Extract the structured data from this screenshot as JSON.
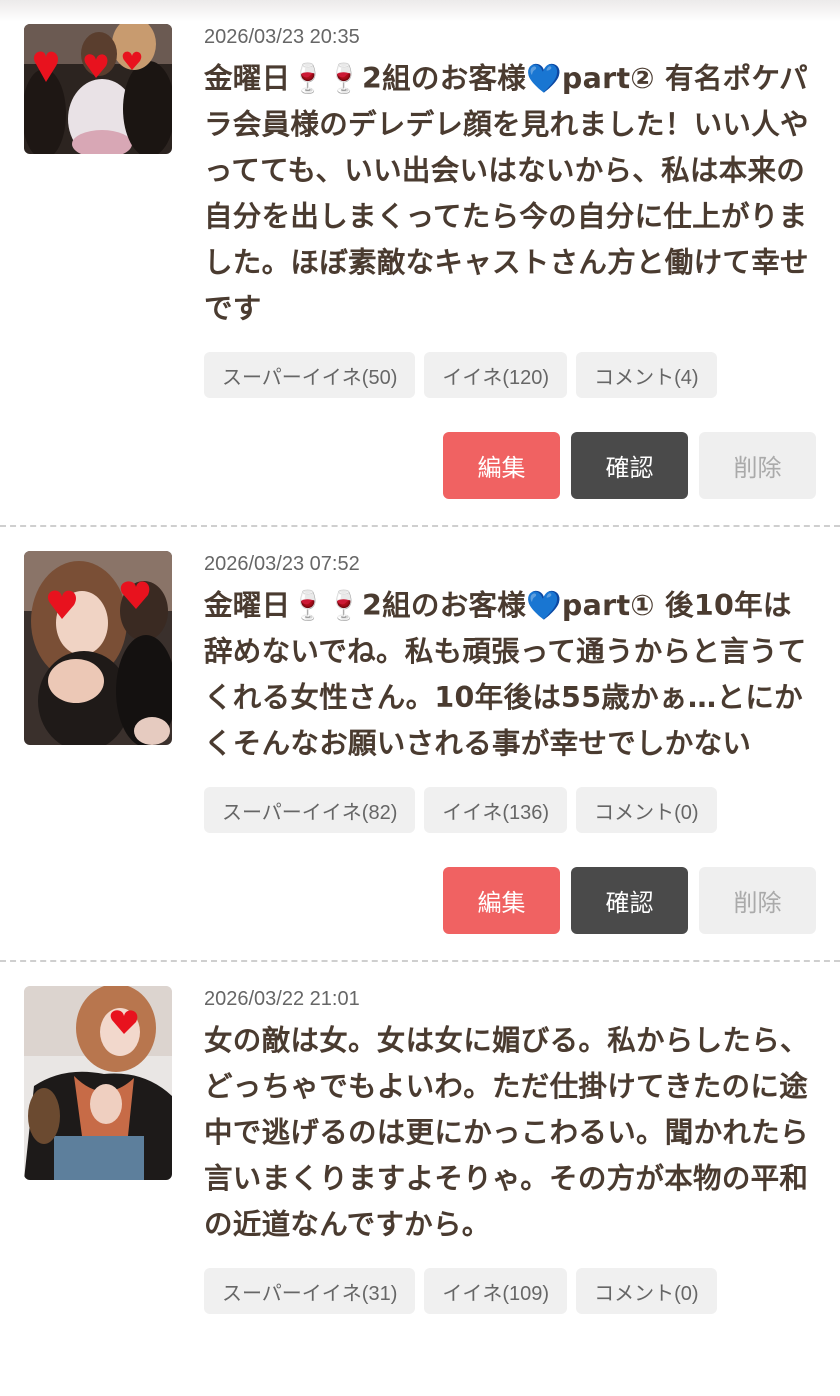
{
  "posts": [
    {
      "date": "2026/03/23 20:35",
      "text": "金曜日🍷🍷2組のお客様💙part② 有名ポケパラ会員様のデレデレ顔を見れました！いい人やってても、いい出会いはないから、私は本来の自分を出しまくってたら今の自分に仕上がりました。ほぼ素敵なキャストさん方と働けて幸せです",
      "superlike": "スーパーイイネ(50)",
      "like": "イイネ(120)",
      "comment": "コメント(4)",
      "edit": "編集",
      "confirm": "確認",
      "delete": "削除",
      "thumb_icon": "photo-thumbnail-icon"
    },
    {
      "date": "2026/03/23 07:52",
      "text": "金曜日🍷🍷2組のお客様💙part① 後10年は辞めないでね。私も頑張って通うからと言うてくれる女性さん。10年後は55歳かぁ…とにかくそんなお願いされる事が幸せでしかない",
      "superlike": "スーパーイイネ(82)",
      "like": "イイネ(136)",
      "comment": "コメント(0)",
      "edit": "編集",
      "confirm": "確認",
      "delete": "削除",
      "thumb_icon": "photo-thumbnail-icon"
    },
    {
      "date": "2026/03/22 21:01",
      "text": "女の敵は女。女は女に媚びる。私からしたら、どっちゃでもよいわ。ただ仕掛けてきたのに途中で逃げるのは更にかっこわるい。聞かれたら言いまくりますよそりゃ。その方が本物の平和の近道なんですから。",
      "superlike": "スーパーイイネ(31)",
      "like": "イイネ(109)",
      "comment": "コメント(0)",
      "thumb_icon": "photo-thumbnail-icon"
    }
  ],
  "colors": {
    "edit_button": "#f06262",
    "confirm_button": "#4a4a4a",
    "delete_button": "#efefef",
    "post_text": "#4a3b30",
    "heart_sticker": "#e8121e"
  }
}
